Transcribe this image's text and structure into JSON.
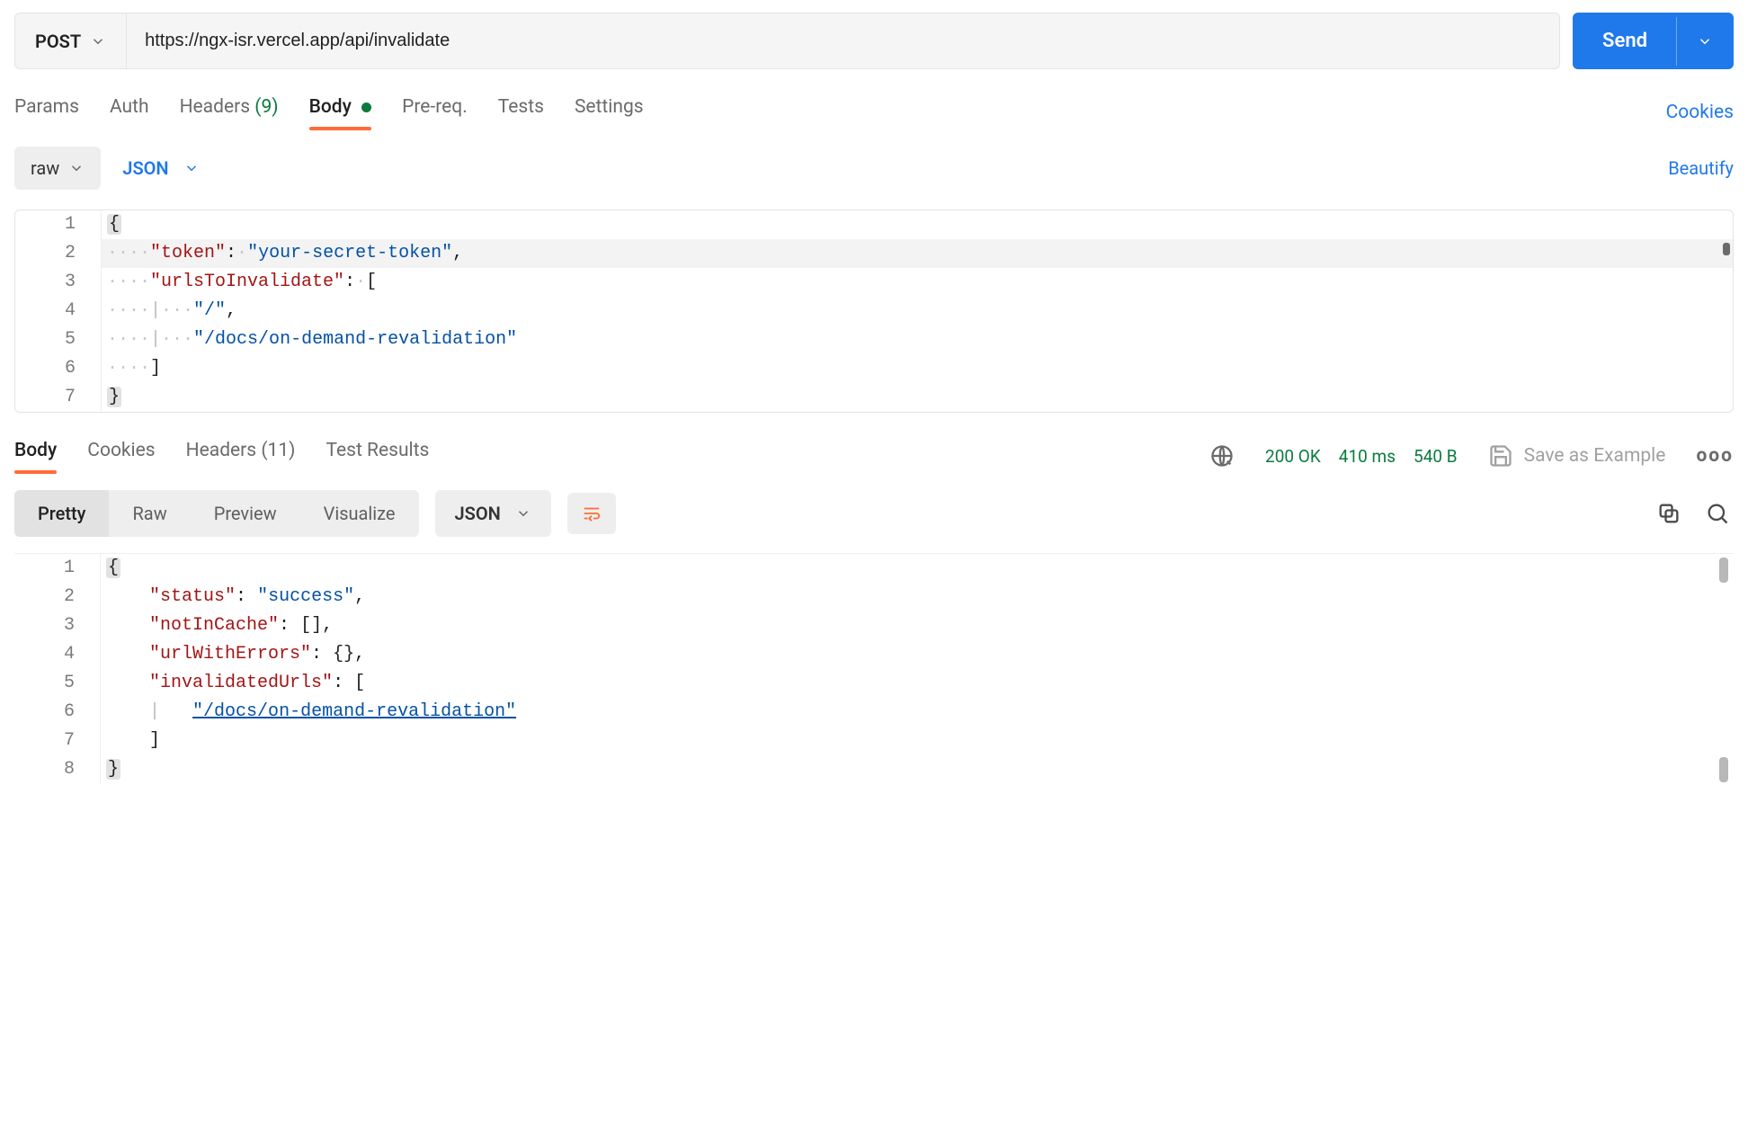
{
  "request": {
    "method": "POST",
    "url": "https://ngx-isr.vercel.app/api/invalidate",
    "send_label": "Send"
  },
  "req_tabs": {
    "params": "Params",
    "auth": "Auth",
    "headers_label": "Headers",
    "headers_count": "(9)",
    "body": "Body",
    "prereq": "Pre-req.",
    "tests": "Tests",
    "settings": "Settings",
    "cookies": "Cookies"
  },
  "body_toolbar": {
    "mode": "raw",
    "type": "JSON",
    "beautify": "Beautify"
  },
  "request_body_display": {
    "lines": [
      "1",
      "2",
      "3",
      "4",
      "5",
      "6",
      "7"
    ]
  },
  "request_body_data": {
    "token": "your-secret-token",
    "urlsToInvalidate": [
      "/",
      "/docs/on-demand-revalidation"
    ]
  },
  "response": {
    "tabs": {
      "body": "Body",
      "cookies": "Cookies",
      "headers_label": "Headers",
      "headers_count": "(11)",
      "test_results": "Test Results"
    },
    "status": "200 OK",
    "time": "410 ms",
    "size": "540 B",
    "save_example": "Save as Example"
  },
  "resp_view": {
    "pretty": "Pretty",
    "raw": "Raw",
    "preview": "Preview",
    "visualize": "Visualize",
    "type": "JSON"
  },
  "response_body_display": {
    "lines": [
      "1",
      "2",
      "3",
      "4",
      "5",
      "6",
      "7",
      "8"
    ]
  },
  "response_body_data": {
    "status": "success",
    "notInCache": [],
    "urlWithErrors": {},
    "invalidatedUrls": [
      "/docs/on-demand-revalidation"
    ]
  }
}
